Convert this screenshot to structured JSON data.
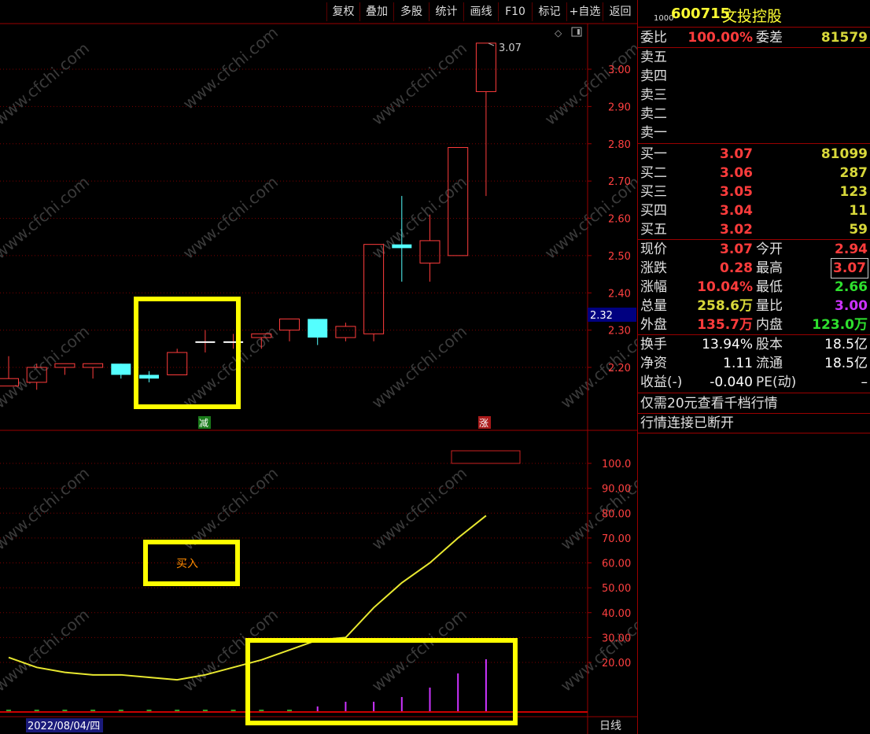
{
  "toolbar": [
    "复权",
    "叠加",
    "多股",
    "统计",
    "画线",
    "F10",
    "标记",
    "+自选",
    "返回"
  ],
  "stock": {
    "prefix": "1000",
    "code": "600715",
    "name": "文投控股"
  },
  "ratio": {
    "label1": "委比",
    "val1": "100.00%",
    "label2": "委差",
    "val2": "81579"
  },
  "sell": [
    {
      "label": "卖五",
      "price": "",
      "vol": ""
    },
    {
      "label": "卖四",
      "price": "",
      "vol": ""
    },
    {
      "label": "卖三",
      "price": "",
      "vol": ""
    },
    {
      "label": "卖二",
      "price": "",
      "vol": ""
    },
    {
      "label": "卖一",
      "price": "",
      "vol": ""
    }
  ],
  "buy": [
    {
      "label": "买一",
      "price": "3.07",
      "vol": "81099"
    },
    {
      "label": "买二",
      "price": "3.06",
      "vol": "287"
    },
    {
      "label": "买三",
      "price": "3.05",
      "vol": "123"
    },
    {
      "label": "买四",
      "price": "3.04",
      "vol": "11"
    },
    {
      "label": "买五",
      "price": "3.02",
      "vol": "59"
    }
  ],
  "quote": [
    {
      "l1": "现价",
      "v1": "3.07",
      "c1": "red",
      "l2": "今开",
      "v2": "2.94",
      "c2": "red"
    },
    {
      "l1": "涨跌",
      "v1": "0.28",
      "c1": "red",
      "l2": "最高",
      "v2": "3.07",
      "c2": "red"
    },
    {
      "l1": "涨幅",
      "v1": "10.04%",
      "c1": "red",
      "l2": "最低",
      "v2": "2.66",
      "c2": "grn"
    },
    {
      "l1": "总量",
      "v1": "258.6万",
      "c1": "yel",
      "l2": "量比",
      "v2": "3.00",
      "c2": "pur"
    },
    {
      "l1": "外盘",
      "v1": "135.7万",
      "c1": "red",
      "l2": "内盘",
      "v2": "123.0万",
      "c2": "grn"
    }
  ],
  "finance": [
    {
      "l1": "换手",
      "v1": "13.94%",
      "l2": "股本",
      "v2": "18.5亿"
    },
    {
      "l1": "净资",
      "v1": "1.11",
      "l2": "流通",
      "v2": "18.5亿"
    },
    {
      "l1": "收益(-)",
      "v1": "-0.040",
      "l2": "PE(动)",
      "v2": "–"
    }
  ],
  "notices": [
    "仅需20元查看千档行情",
    "行情连接已断开"
  ],
  "chart": {
    "price_ticks": [
      "3.00",
      "2.90",
      "2.80",
      "2.70",
      "2.60",
      "2.50",
      "2.40",
      "2.30",
      "2.20"
    ],
    "price_values": [
      3.0,
      2.9,
      2.8,
      2.7,
      2.6,
      2.5,
      2.4,
      2.3,
      2.2
    ],
    "current_price_tag": "2.32",
    "high_label": "3.07",
    "mark_reduce": "减",
    "mark_rise": "涨",
    "buy_signal": "买入",
    "ind_ticks": [
      "100.0",
      "90.00",
      "80.00",
      "70.00",
      "60.00",
      "50.00",
      "40.00",
      "30.00",
      "20.00"
    ],
    "ind_values": [
      100,
      90,
      80,
      70,
      60,
      50,
      40,
      30,
      20
    ],
    "date_label": "2022/08/04/四",
    "period_label": "日线",
    "watermark": "www.cfchi.com"
  },
  "chart_data": {
    "type": "candlestick",
    "candles": [
      {
        "o": 2.15,
        "c": 2.17,
        "h": 2.23,
        "l": 2.15
      },
      {
        "o": 2.16,
        "c": 2.2,
        "h": 2.21,
        "l": 2.14
      },
      {
        "o": 2.2,
        "c": 2.21,
        "h": 2.21,
        "l": 2.18
      },
      {
        "o": 2.2,
        "c": 2.21,
        "h": 2.21,
        "l": 2.17
      },
      {
        "o": 2.21,
        "c": 2.18,
        "h": 2.21,
        "l": 2.17
      },
      {
        "o": 2.18,
        "c": 2.17,
        "h": 2.19,
        "l": 2.16
      },
      {
        "o": 2.18,
        "c": 2.24,
        "h": 2.25,
        "l": 2.18
      },
      {
        "o": 2.27,
        "c": 2.27,
        "h": 2.3,
        "l": 2.24
      },
      {
        "o": 2.27,
        "c": 2.27,
        "h": 2.29,
        "l": 2.25
      },
      {
        "o": 2.28,
        "c": 2.29,
        "h": 2.29,
        "l": 2.25
      },
      {
        "o": 2.3,
        "c": 2.33,
        "h": 2.33,
        "l": 2.27
      },
      {
        "o": 2.33,
        "c": 2.28,
        "h": 2.33,
        "l": 2.26
      },
      {
        "o": 2.28,
        "c": 2.31,
        "h": 2.32,
        "l": 2.27
      },
      {
        "o": 2.29,
        "c": 2.53,
        "h": 2.53,
        "l": 2.27
      },
      {
        "o": 2.53,
        "c": 2.52,
        "h": 2.66,
        "l": 2.43
      },
      {
        "o": 2.48,
        "c": 2.54,
        "h": 2.61,
        "l": 2.43
      },
      {
        "o": 2.5,
        "c": 2.79,
        "h": 2.79,
        "l": 2.5
      },
      {
        "o": 2.94,
        "c": 3.07,
        "h": 3.07,
        "l": 2.66
      }
    ],
    "indicator_line": [
      22,
      18,
      16,
      15,
      15,
      14,
      13,
      15,
      18,
      21,
      25,
      29,
      30,
      42,
      52,
      60,
      70,
      79
    ],
    "indicator_bars": [
      0,
      0,
      0,
      0,
      0,
      0,
      0,
      0,
      0,
      0,
      0,
      1,
      2,
      2,
      3,
      5,
      8,
      11
    ],
    "ylim_price": [
      2.1,
      3.1
    ],
    "ylim_indicator": [
      10,
      105
    ]
  }
}
